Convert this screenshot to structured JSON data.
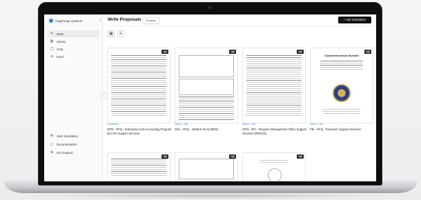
{
  "sidebar": {
    "org_name": "HugeForge Systems",
    "nav": [
      {
        "label": "Write",
        "icon": "pen-icon",
        "active": true
      },
      {
        "label": "Library",
        "icon": "book-icon",
        "active": false
      },
      {
        "label": "Chat",
        "icon": "chat-icon",
        "active": false
      },
      {
        "label": "Feed",
        "icon": "feed-icon",
        "active": false
      }
    ],
    "footer": [
      {
        "label": "Start Simulation",
        "icon": "gear-icon"
      },
      {
        "label": "Documentation",
        "icon": "info-icon"
      },
      {
        "label": "Get Support",
        "icon": "help-icon"
      }
    ]
  },
  "header": {
    "title": "Write Proposals",
    "issues_label": "Issues",
    "add_button": "+ Add Solicitation"
  },
  "cards": [
    {
      "badge": "1Q8",
      "status": "Complete",
      "status_color": "#2e9e4b",
      "title": "OPM - RFQ - Enterprise Cost Accounting Program (ECAP) Support Services"
    },
    {
      "badge": "1Q8",
      "status": "Step 1: Top",
      "status_color": "#2f7cf6",
      "title": "DOL - RFQ - 1605C6-26-Q-00002"
    },
    {
      "badge": "1Q8",
      "status": "Step 1: Top",
      "status_color": "#2f7cf6",
      "title": "OPM - RFI - Program Management Office Support Services (PMOSS)"
    },
    {
      "badge": "1Q8",
      "status": "Step 1: Top",
      "status_color": "#2f7cf6",
      "title": "FBI - RFQ - Research Support Services"
    }
  ],
  "row2_badges": [
    "1Q8",
    "1Q8",
    "1Q8"
  ],
  "fbi_doc_title": "Counterterrorism Division",
  "colors": {
    "accent": "#2f7cf6",
    "complete": "#2e9e4b",
    "primary_button": "#111111"
  }
}
